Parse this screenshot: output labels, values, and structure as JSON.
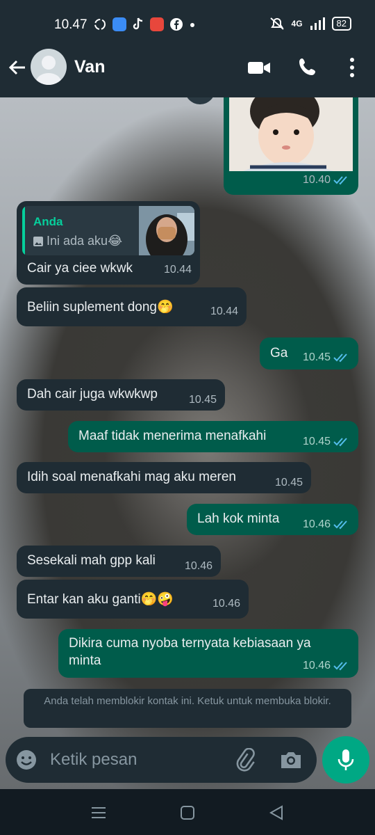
{
  "status_bar": {
    "time": "10.47",
    "network": "4G",
    "battery": "82",
    "app_icons": [
      "sync-icon",
      "messenger-icon",
      "tiktok-icon",
      "wps-icon",
      "facebook-icon",
      "more-dot-icon"
    ]
  },
  "header": {
    "contact_name": "Van",
    "icons": [
      "back-arrow-icon",
      "avatar",
      "video-call-icon",
      "phone-call-icon",
      "more-vert-icon"
    ]
  },
  "photo_message": {
    "time": "10.40",
    "status": "read"
  },
  "messages": [
    {
      "direction": "in",
      "reply": {
        "author": "Anda",
        "text": "Ini ada aku😂",
        "icon": "photo-icon"
      },
      "text": "Cair ya ciee wkwk",
      "time": "10.44"
    },
    {
      "direction": "in",
      "text": "Beliin suplement dong🤭",
      "time": "10.44"
    },
    {
      "direction": "out",
      "text": "Ga",
      "time": "10.45",
      "status": "read"
    },
    {
      "direction": "in",
      "text": "Dah cair juga wkwkwp",
      "time": "10.45"
    },
    {
      "direction": "out",
      "text": "Maaf tidak menerima menafkahi",
      "time": "10.45",
      "status": "read"
    },
    {
      "direction": "in",
      "text": "Idih soal menafkahi mag aku meren",
      "time": "10.45"
    },
    {
      "direction": "out",
      "text": "Lah kok minta",
      "time": "10.46",
      "status": "read"
    },
    {
      "direction": "in",
      "text": "Sesekali mah gpp kali",
      "time": "10.46"
    },
    {
      "direction": "in",
      "text": "Entar kan aku ganti🤭🤪",
      "time": "10.46"
    },
    {
      "direction": "out",
      "text_line1": "Dikira cuma nyoba ternyata kebiasaan ya",
      "text_line2": "minta",
      "time": "10.46",
      "status": "read"
    }
  ],
  "blocked_notice": "Anda telah memblokir kontak ini. Ketuk untuk membuka blokir.",
  "composer": {
    "placeholder": "Ketik pesan",
    "icons": [
      "emoji-icon",
      "attach-icon",
      "camera-icon",
      "mic-icon"
    ]
  },
  "nav": [
    "menu-icon",
    "home-icon",
    "back-icon"
  ],
  "colors": {
    "header_bg": "#1f2c34",
    "incoming_bubble": "#1f2c34",
    "outgoing_bubble": "#005c4b",
    "accent": "#00a884",
    "read_ticks": "#53bdeb"
  }
}
